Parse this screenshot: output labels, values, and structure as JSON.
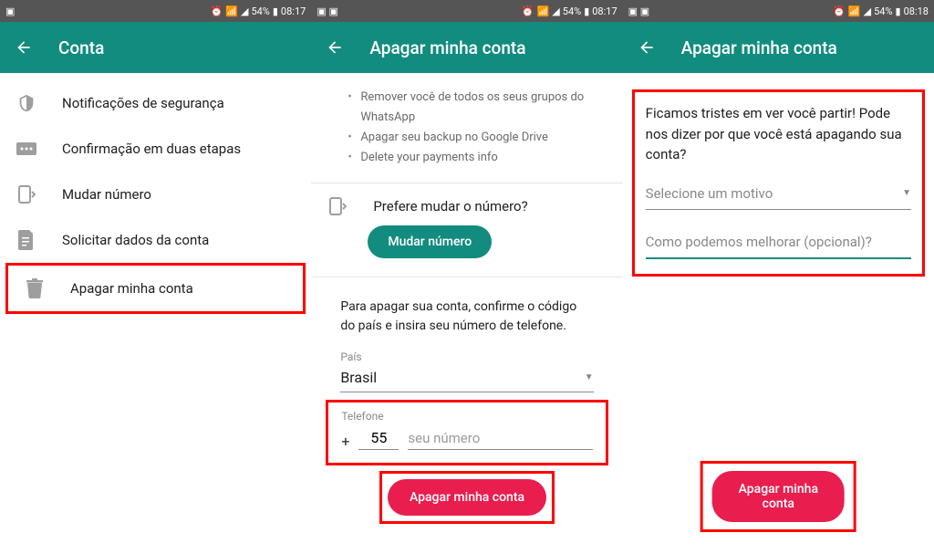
{
  "status": {
    "battery": "54%",
    "time1": "08:17",
    "time2": "08:17",
    "time3": "08:18"
  },
  "screen1": {
    "title": "Conta",
    "items": [
      {
        "label": "Notificações de segurança"
      },
      {
        "label": "Confirmação em duas etapas"
      },
      {
        "label": "Mudar número"
      },
      {
        "label": "Solicitar dados da conta"
      },
      {
        "label": "Apagar minha conta"
      }
    ]
  },
  "screen2": {
    "title": "Apagar minha conta",
    "bullets": [
      "Remover você de todos os seus grupos do WhatsApp",
      "Apagar seu backup no Google Drive",
      "Delete your payments info"
    ],
    "prefer": "Prefere mudar o número?",
    "change_btn": "Mudar número",
    "confirm_text": "Para apagar sua conta, confirme o código do país e insira seu número de telefone.",
    "country_label": "País",
    "country": "Brasil",
    "phone_label": "Telefone",
    "phone_code": "55",
    "phone_placeholder": "seu número",
    "delete_btn": "Apagar minha conta"
  },
  "screen3": {
    "title": "Apagar minha conta",
    "sad_text": "Ficamos tristes em ver você partir! Pode nos dizer por que você está apagando sua conta?",
    "reason_placeholder": "Selecione um motivo",
    "improve_placeholder": "Como podemos melhorar (opcional)?",
    "delete_btn": "Apagar minha conta"
  }
}
